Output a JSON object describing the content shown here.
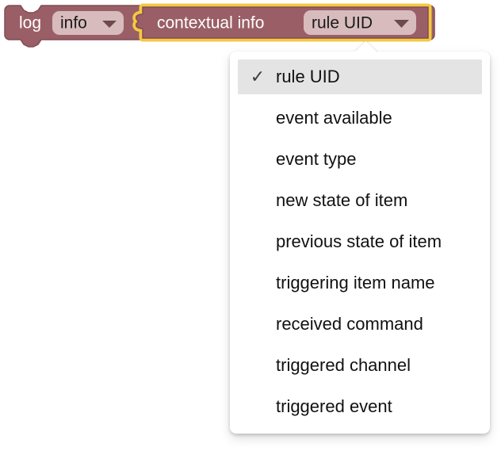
{
  "block": {
    "statement_label": "log",
    "severity_field": {
      "value": "info",
      "arrow_icon": "chevron-down-icon"
    },
    "value_block": {
      "label": "contextual info",
      "selected": true,
      "field": {
        "value": "rule UID",
        "arrow_icon": "chevron-down-icon"
      }
    },
    "colors": {
      "block_fill": "#9a5f66",
      "block_stroke": "#7f4d53",
      "field_fill": "#d8bcbd",
      "field_text": "#1a1a1a",
      "block_text": "#ffffff",
      "selection_highlight": "#f5c842"
    }
  },
  "dropdown": {
    "open": true,
    "check_icon": "✓",
    "selected_index": 0,
    "items": [
      {
        "label": "rule UID"
      },
      {
        "label": "event available"
      },
      {
        "label": "event type"
      },
      {
        "label": "new state of item"
      },
      {
        "label": "previous state of item"
      },
      {
        "label": "triggering item name"
      },
      {
        "label": "received command"
      },
      {
        "label": "triggered channel"
      },
      {
        "label": "triggered event"
      }
    ]
  }
}
